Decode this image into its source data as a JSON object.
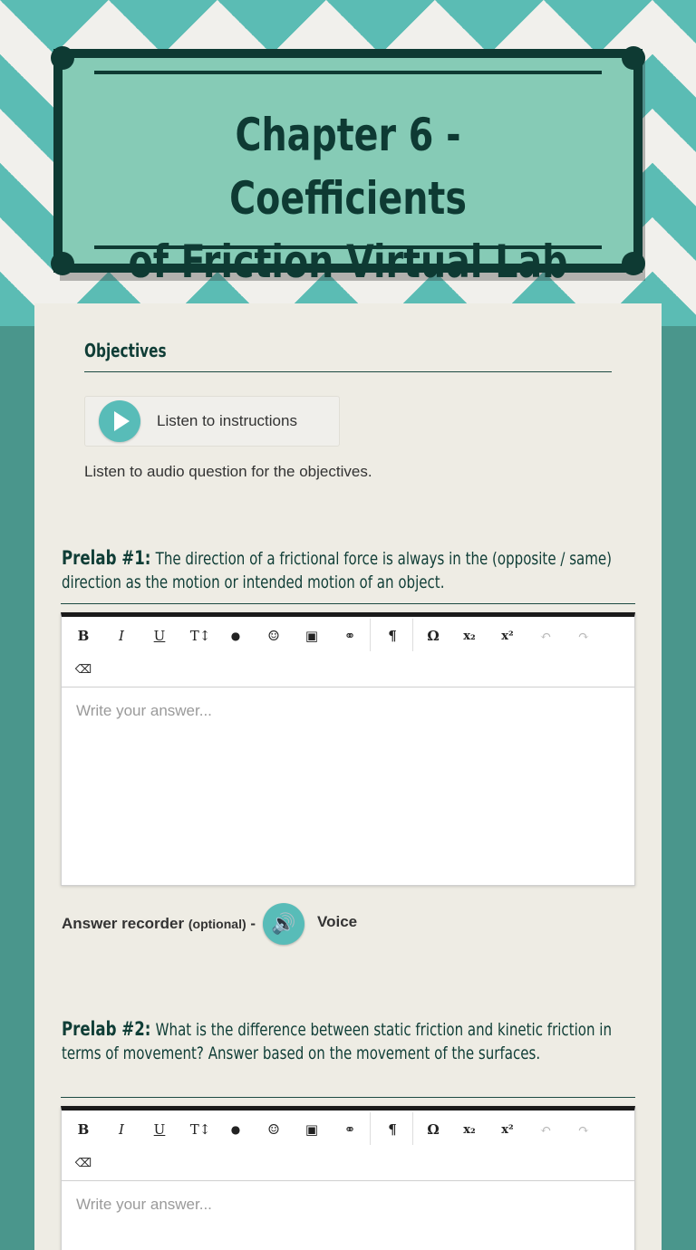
{
  "header": {
    "title_line1": "Chapter 6 - Coefficients",
    "title_line2": "of Friction Virtual Lab"
  },
  "objectives": {
    "heading": "Objectives",
    "listen_label": "Listen to instructions",
    "description": "Listen to audio question for the objectives."
  },
  "prelab1": {
    "lead": "Prelab #1:",
    "text": "The direction of a frictional force is always in the (opposite / same) direction as the motion or intended motion of an object.",
    "placeholder": "Write your answer..."
  },
  "recorder": {
    "label": "Answer recorder",
    "optional": "(optional)",
    "dash": "-",
    "voice_label": "Voice"
  },
  "prelab2": {
    "lead": "Prelab #2:",
    "text": "What is the difference between static friction and kinetic friction in terms of movement? Answer based on the movement of the surfaces.",
    "placeholder": "Write your answer..."
  },
  "toolbar": {
    "bold": "B",
    "italic": "I",
    "underline": "U",
    "text_size": "T↕",
    "color": "●",
    "emoji": "☺",
    "image": "▣",
    "link": "⚭",
    "paragraph": "¶",
    "omega": "Ω",
    "subscript": "x₂",
    "superscript": "x²",
    "undo": "↶",
    "redo": "↷",
    "eraser": "⌫"
  },
  "colors": {
    "accent": "#58bcb8",
    "dark": "#0e3a33",
    "plaque": "#86cbb6",
    "paper": "#eeece4"
  }
}
